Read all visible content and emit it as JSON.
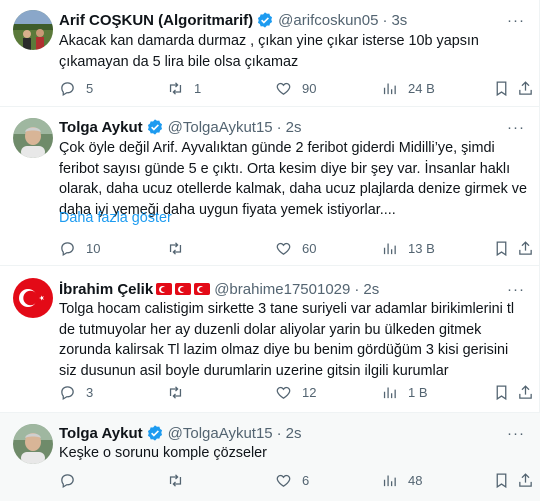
{
  "tweets": [
    {
      "name": "Arif COŞKUN (Algoritmarif)",
      "handle": "@arifcoskun05",
      "time": "3s",
      "text": "Akacak kan damarda durmaz , çıkan yine çıkar isterse 10b yapsın çıkamayan da 5 lira bile olsa çıkamaz",
      "show_more": "",
      "reply": "5",
      "retweet": "1",
      "like": "90",
      "views": "24 B",
      "flags": 0
    },
    {
      "name": "Tolga Aykut",
      "handle": "@TolgaAykut15",
      "time": "2s",
      "text": "Çok öyle değil Arif. Ayvalıktan günde 2 feribot giderdi Midilli’ye, şimdi feribot sayısı günde 5 e çıktı. Orta kesim diye bir şey var. İnsanlar haklı olarak, daha ucuz otellerde kalmak, daha ucuz plajlarda denize girmek ve daha iyi yemeği daha uygun fiyata yemek istiyorlar....",
      "show_more": "Daha fazla göster",
      "reply": "10",
      "retweet": "",
      "like": "60",
      "views": "13 B",
      "flags": 0
    },
    {
      "name": "İbrahim Çelik",
      "handle": "@brahime17501029",
      "time": "2s",
      "text": "Tolga hocam calistigim sirkette 3 tane suriyeli var adamlar birikimlerini tl de tutmuyolar her ay duzenli dolar aliyolar yarin bu ülkeden gitmek zorunda kalirsak Tl lazim olmaz diye bu benim gördüğüm 3 kisi gerisini siz dusunun asil boyle durumlarin uzerine gitsin ilgili kurumlar",
      "show_more": "",
      "reply": "3",
      "retweet": "",
      "like": "12",
      "views": "1 B",
      "flags": 3
    },
    {
      "name": "Tolga Aykut",
      "handle": "@TolgaAykut15",
      "time": "2s",
      "text": "Keşke o sorunu komple çözseler",
      "show_more": "",
      "reply": "",
      "retweet": "",
      "like": "6",
      "views": "48",
      "flags": 0
    }
  ],
  "icons": {
    "more": "ellipsis-icon",
    "reply": "reply-icon",
    "retweet": "retweet-icon",
    "like": "heart-icon",
    "views": "views-icon",
    "bookmark": "bookmark-icon",
    "share": "share-icon",
    "verified": "verified-badge-icon"
  },
  "colors": {
    "verified": "#1d9bf0",
    "link": "#1d9bf0",
    "muted": "#536471",
    "flag": "#e30a17"
  }
}
